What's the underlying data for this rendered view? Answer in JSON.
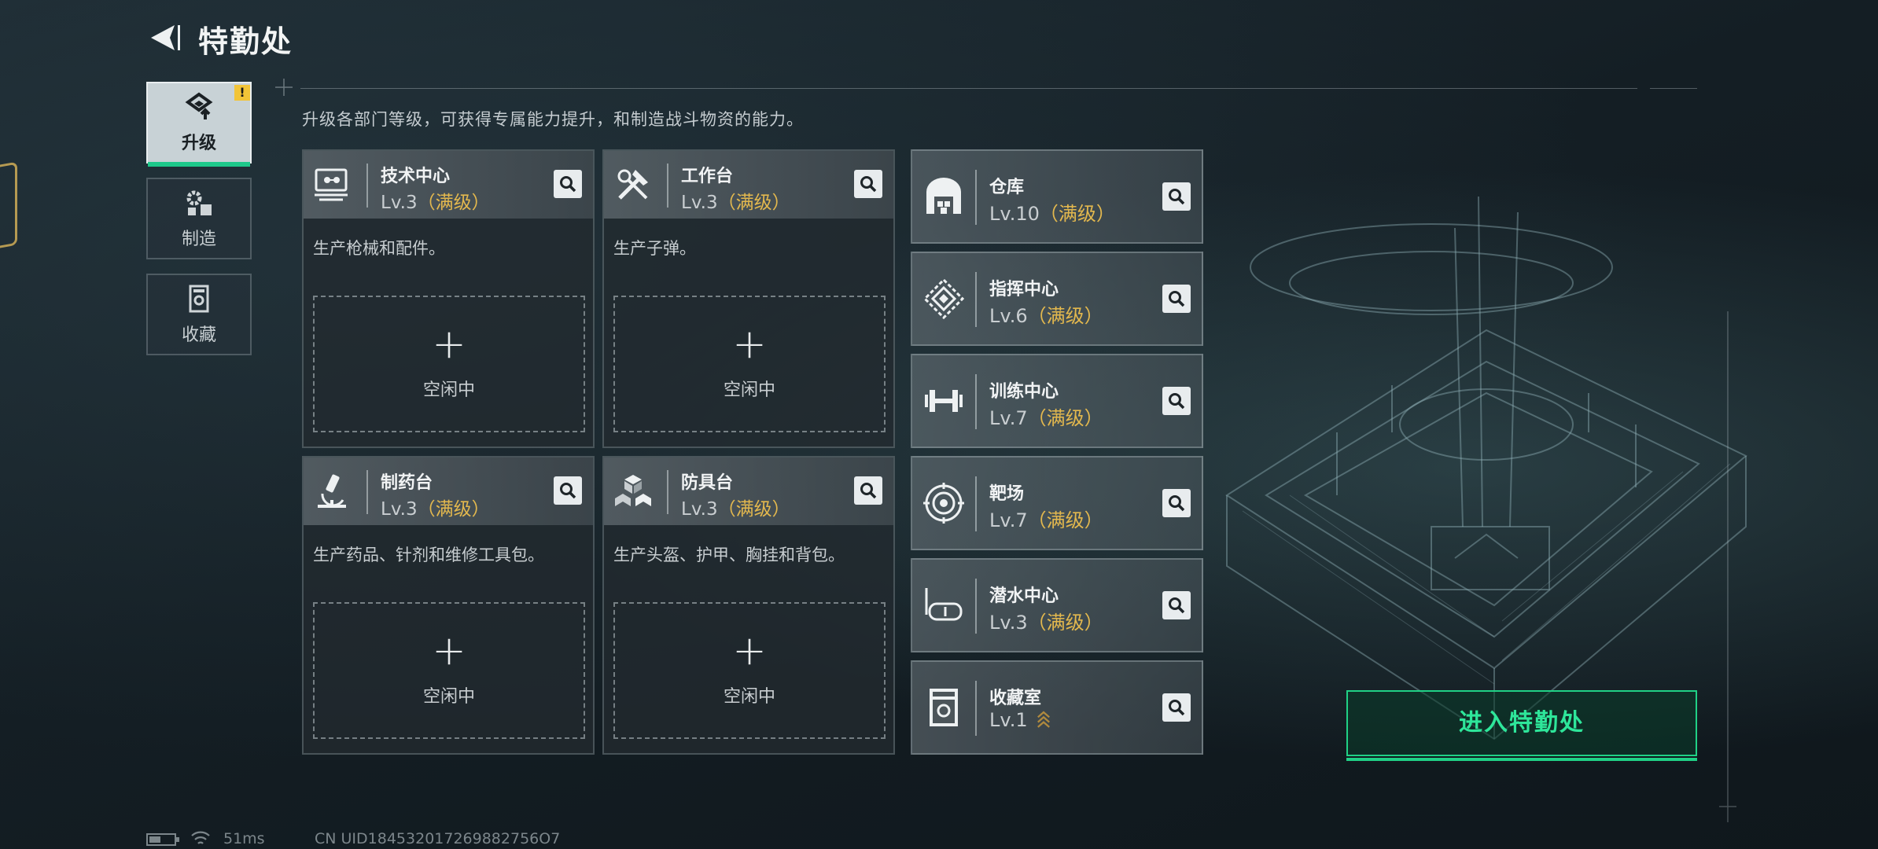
{
  "header": {
    "title": "特勤处"
  },
  "nav": [
    {
      "label": "升级",
      "icon": "upgrade-icon",
      "active": true,
      "badge": "!"
    },
    {
      "label": "制造",
      "icon": "gears-icon",
      "active": false
    },
    {
      "label": "收藏",
      "icon": "collection-icon",
      "active": false
    }
  ],
  "description": "升级各部门等级，可获得专属能力提升，和制造战斗物资的能力。",
  "departments": [
    {
      "name": "技术中心",
      "level": "Lv.3",
      "max": "（满级）",
      "desc": "生产枪械和配件。",
      "slot_plus": "+",
      "slot_label": "空闲中",
      "icon": "monitor-icon"
    },
    {
      "name": "工作台",
      "level": "Lv.3",
      "max": "（满级）",
      "desc": "生产子弹。",
      "slot_plus": "+",
      "slot_label": "空闲中",
      "icon": "tools-icon"
    },
    {
      "name": "制药台",
      "level": "Lv.3",
      "max": "（满级）",
      "desc": "生产药品、针剂和维修工具包。",
      "slot_plus": "+",
      "slot_label": "空闲中",
      "icon": "microscope-icon"
    },
    {
      "name": "防具台",
      "level": "Lv.3",
      "max": "（满级）",
      "desc": "生产头盔、护甲、胸挂和背包。",
      "slot_plus": "+",
      "slot_label": "空闲中",
      "icon": "cubes-icon"
    }
  ],
  "facilities": [
    {
      "name": "仓库",
      "level": "Lv.10",
      "max": "（满级）",
      "icon": "warehouse-icon"
    },
    {
      "name": "指挥中心",
      "level": "Lv.6",
      "max": "（满级）",
      "icon": "command-icon"
    },
    {
      "name": "训练中心",
      "level": "Lv.7",
      "max": "（满级）",
      "icon": "dumbbell-icon"
    },
    {
      "name": "靶场",
      "level": "Lv.7",
      "max": "（满级）",
      "icon": "target-icon"
    },
    {
      "name": "潜水中心",
      "level": "Lv.3",
      "max": "（满级）",
      "icon": "diving-mask-icon"
    },
    {
      "name": "收藏室",
      "level": "Lv.1",
      "max": "",
      "icon": "collection-room-icon",
      "upgrade": "upgrade-arrows-icon"
    }
  ],
  "enter_button": "进入特勤处",
  "status": {
    "ping": "51ms",
    "uid": "CN UID184532017269882756O7"
  },
  "colors": {
    "accent_green": "#20d186",
    "max_gold": "#e3b84e",
    "badge_yellow": "#f2c437"
  }
}
